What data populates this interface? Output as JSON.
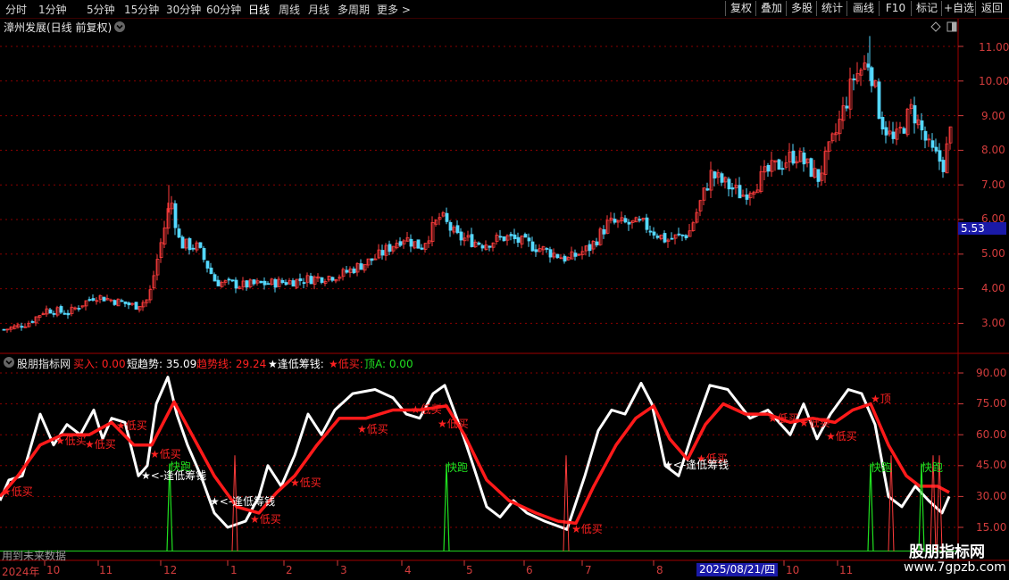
{
  "toolbar": {
    "tabs": [
      "分时",
      "1分钟",
      "5分钟",
      "15分钟",
      "30分钟",
      "60分钟",
      "日线",
      "周线",
      "月线",
      "多周期",
      "更多 >"
    ],
    "active_tab": "日线",
    "right_buttons": [
      "复权",
      "叠加",
      "多股",
      "统计",
      "画线",
      "F10",
      "标记",
      "+自选",
      "返回"
    ]
  },
  "main_chart": {
    "title": "漳州发展(日线 前复权)",
    "price_labels": [
      "11.00",
      "10.00",
      "9.00",
      "8.00",
      "7.00",
      "6.00",
      "5.00",
      "4.00",
      "3.00"
    ],
    "current_price": "5.53"
  },
  "indicator": {
    "name": "股朋指标网",
    "legend": [
      {
        "text": "买入: 0.00",
        "color": "#ff2020"
      },
      {
        "text": "短趋势: 35.09",
        "color": "#ffffff"
      },
      {
        "text": "趋势线: 29.24",
        "color": "#ff2020"
      },
      {
        "text": "★逢低筹钱:",
        "color": "#ffffff"
      },
      {
        "text": "★低买:",
        "color": "#ff2020"
      },
      {
        "text": "顶A: 0.00",
        "color": "#20e020"
      }
    ],
    "scale_labels": [
      "90.00",
      "75.00",
      "60.00",
      "45.00",
      "30.00",
      "15.00"
    ],
    "annotations": {
      "low_buy": "低买",
      "chip": "<-逢低筹钱",
      "run": "快跑",
      "top": "顶"
    },
    "future_note": "用到未来数据"
  },
  "time_axis": {
    "months": [
      "2024年",
      "10",
      "11",
      "12",
      "1",
      "2",
      "3",
      "4",
      "5",
      "6",
      "7",
      "8",
      "9",
      "10",
      "11"
    ],
    "selected_date": "2025/08/21/四"
  },
  "watermark": {
    "line1": "股朋指标网",
    "line2": "www.7gpzb.com"
  },
  "colors": {
    "up": "#ff3c3c",
    "down": "#54d8ff",
    "short_trend": "#ffffff",
    "trend_line": "#ff1a1a",
    "run_signal": "#20e020",
    "grid": "#8a0000"
  }
}
